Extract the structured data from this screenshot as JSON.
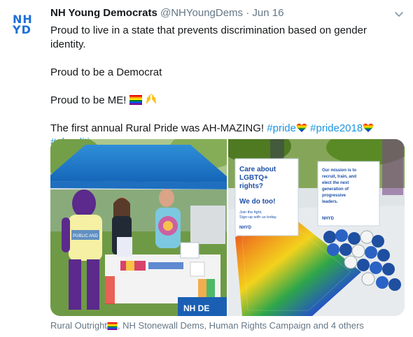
{
  "account": {
    "avatar_line1": "NH",
    "avatar_line2": "YD",
    "name": "NH Young Democrats",
    "handle": "@NHYoungDems",
    "separator": "·",
    "time": "Jun 16"
  },
  "tweet": {
    "line1": "Proud to live in a state that prevents discrimination based on gender identity.",
    "line2": "Proud to be a Democrat",
    "line3": "Proud to be ME!",
    "line4_text": "The first annual Rural Pride was AH-MAZING! ",
    "hashtag_pride": "#pride",
    "hashtag_pride2018": "#pride2018",
    "hashtag_nhpolitics": "#nhpolitics"
  },
  "photo_left": {
    "shirt_text": "PUBLIC AND",
    "banner_text": "NH DE"
  },
  "photo_right": {
    "sign1_lines": [
      "Care about",
      "LGBTQ+",
      "rights?",
      "We do too!",
      "Join the fight.",
      "Sign-up with us today.",
      "NHYD"
    ],
    "sign2_lines": [
      "Our mission is to",
      "recruit, train, and",
      "elect the next",
      "generation of",
      "progressive",
      "leaders.",
      "NHYD"
    ]
  },
  "caption": {
    "text1": "Rural Outright",
    "text2": ", NH Stonewall Dems, Human Rights Campaign and 4 others"
  },
  "colors": {
    "brand_blue": "#1d6fd8",
    "link_blue": "#1b95e0",
    "muted_gray": "#657786"
  },
  "icons": [
    "chevron-down-icon",
    "rainbow-flag-icon",
    "raised-hands-icon",
    "rainbow-heart-icon"
  ]
}
